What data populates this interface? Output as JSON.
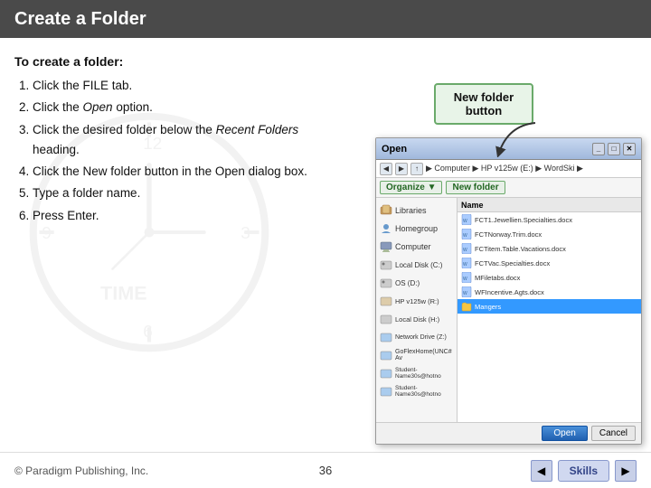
{
  "header": {
    "title": "Create a Folder"
  },
  "instructions": {
    "intro": "To create a folder:",
    "steps": [
      {
        "num": "1.",
        "text": "Click the FILE tab."
      },
      {
        "num": "2.",
        "text_before": "Click the ",
        "italic": "Open",
        "text_after": " option."
      },
      {
        "num": "3.",
        "text_before": "Click the desired folder below the ",
        "italic": "Recent Folders",
        "text_after": " heading."
      },
      {
        "num": "4.",
        "text": "Click the New folder button in the Open dialog box."
      },
      {
        "num": "5.",
        "text": "Type a folder name."
      },
      {
        "num": "6.",
        "text": "Press Enter."
      }
    ]
  },
  "callout": {
    "label": "New folder button"
  },
  "dialog": {
    "title": "Open",
    "address_bar": "▶ Computer ▶ HP v125w (E:) ▶ WordSki ▶",
    "toolbar_buttons": [
      "Organize ▼",
      "New folder"
    ],
    "nav_items": [
      {
        "label": "Libraries",
        "icon": "library"
      },
      {
        "label": "Homegroup",
        "icon": "homegroup"
      },
      {
        "label": "Computer",
        "icon": "computer"
      },
      {
        "label": "Local Disk (C:)",
        "icon": "disk"
      },
      {
        "label": "OS (D:)",
        "icon": "disk"
      },
      {
        "label": "HP v125w (R:)",
        "icon": "disk"
      },
      {
        "label": "Local Disk (H:)",
        "icon": "disk"
      },
      {
        "label": "Network Drive (Z:)",
        "icon": "disk"
      },
      {
        "label": "GoFlexHome(UNC# Av",
        "icon": "disk"
      },
      {
        "label": "Student-Name30s@hotno",
        "icon": "disk"
      },
      {
        "label": "Student-Name30s@hotno",
        "icon": "disk"
      }
    ],
    "file_panel": {
      "header": "Name",
      "files": [
        {
          "name": "FCT1.Jewellien.Specialties.docx",
          "selected": false
        },
        {
          "name": "FCTNorway.Trim.docx",
          "selected": false
        },
        {
          "name": "FCTitem.Table.Vacations.docx",
          "selected": false
        },
        {
          "name": "FCTVac.Specialties.docx",
          "selected": false
        },
        {
          "name": "MFiletabs.docx",
          "selected": false
        },
        {
          "name": "WFIncentive.Agts.docx",
          "selected": false
        },
        {
          "name": "Mangers",
          "selected": true
        }
      ]
    },
    "buttons": {
      "save": "Open",
      "cancel": "Cancel"
    }
  },
  "footer": {
    "copyright": "© Paradigm Publishing, Inc.",
    "page_number": "36",
    "skills_label": "Skills",
    "prev_arrow": "◀",
    "next_arrow": "▶"
  }
}
